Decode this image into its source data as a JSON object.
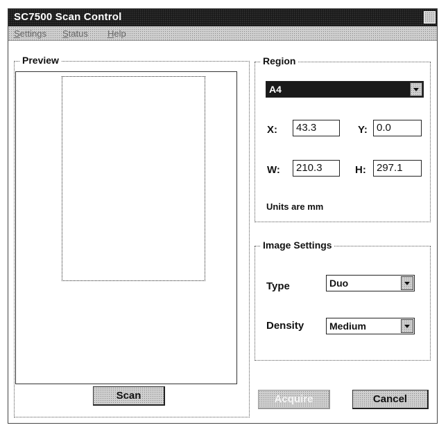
{
  "window": {
    "title": "SC7500 Scan Control"
  },
  "menu": {
    "items": [
      {
        "mnemonic": "S",
        "rest": "ettings"
      },
      {
        "mnemonic": "S",
        "rest": "tatus"
      },
      {
        "mnemonic": "H",
        "rest": "elp"
      }
    ]
  },
  "preview": {
    "label": "Preview",
    "scan_button": "Scan"
  },
  "region": {
    "label": "Region",
    "preset": "A4",
    "x_label": "X:",
    "x": "43.3",
    "y_label": "Y:",
    "y": "0.0",
    "w_label": "W:",
    "w": "210.3",
    "h_label": "H:",
    "h": "297.1",
    "units_note": "Units are mm"
  },
  "image_settings": {
    "label": "Image Settings",
    "type_label": "Type",
    "type_value": "Duo",
    "density_label": "Density",
    "density_value": "Medium"
  },
  "actions": {
    "acquire": "Acquire",
    "cancel": "Cancel"
  }
}
